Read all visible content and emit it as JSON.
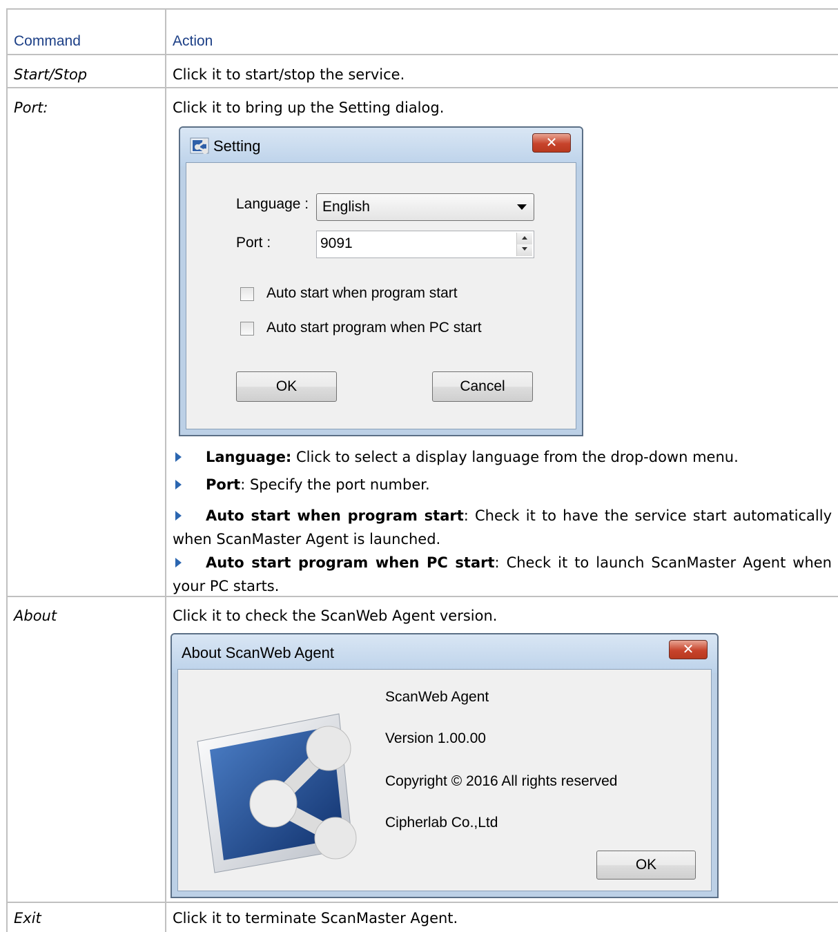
{
  "table": {
    "headers": {
      "command": "Command",
      "action": "Action"
    },
    "rows": {
      "start_stop": {
        "command": "Start/Stop",
        "action": "Click it to start/stop the service."
      },
      "port": {
        "command": "Port:",
        "action": "Click it to bring up the Setting dialog."
      },
      "about": {
        "command": "About",
        "action": "Click it to check the ScanWeb Agent version."
      },
      "exit": {
        "command": "Exit",
        "action": "Click it to terminate ScanMaster Agent."
      }
    }
  },
  "setting_dialog": {
    "title": "Setting",
    "close_glyph": "✕",
    "language_label": "Language :",
    "language_value": "English",
    "port_label": "Port :",
    "port_value": "9091",
    "auto_start_service": "Auto start when program start",
    "auto_start_program": "Auto start program when PC start",
    "ok": "OK",
    "cancel": "Cancel"
  },
  "bullets": [
    {
      "term": "Language:",
      "text": " Click to select a display language from the drop-down menu."
    },
    {
      "term": "Port",
      "text": ": Specify the port number."
    },
    {
      "term": "Auto start when program start",
      "text": ": Check it to have the service start automatically when ScanMaster Agent is launched."
    },
    {
      "term": "Auto start program when PC start",
      "text": ": Check it to launch ScanMaster Agent when your PC starts."
    }
  ],
  "about_dialog": {
    "title": "About ScanWeb Agent",
    "close_glyph": "✕",
    "product": "ScanWeb Agent",
    "version": "Version 1.00.00",
    "copyright": "Copyright © 2016 All rights reserved",
    "company": "Cipherlab Co.,Ltd",
    "ok": "OK"
  },
  "colors": {
    "header_text": "#1c3f86",
    "bullet": "#2b66b0",
    "grid": "#c0c0c0"
  }
}
